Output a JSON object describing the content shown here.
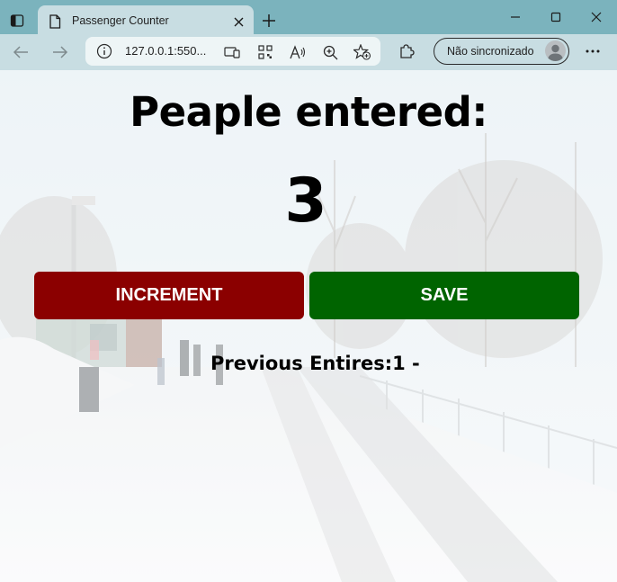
{
  "browser": {
    "tab_title": "Passenger Counter",
    "url": "127.0.0.1:550...",
    "profile_label": "Não sincronizado"
  },
  "page": {
    "heading": "Peaple entered:",
    "count": "3",
    "increment_label": "INCREMENT",
    "save_label": "SAVE",
    "previous_label": "Previous Entires:",
    "previous_entries": "1 -"
  },
  "colors": {
    "titlebar": "#7bb3bd",
    "toolbar": "#c8dde2",
    "increment_button": "#8b0000",
    "save_button": "#006400"
  },
  "icons": {
    "tab_actions": "tab-actions-icon",
    "favicon": "page-icon",
    "tab_close": "close-icon",
    "new_tab": "plus-icon",
    "minimize": "minimize-icon",
    "maximize": "maximize-icon",
    "close_window": "close-icon",
    "back": "arrow-left-icon",
    "forward": "arrow-right-icon",
    "site_info": "info-icon",
    "app_available": "app-install-icon",
    "qr": "qr-code-icon",
    "read_aloud": "read-aloud-icon",
    "zoom": "zoom-in-icon",
    "favorite": "add-favorite-icon",
    "extensions": "extensions-icon",
    "more": "more-icon"
  }
}
